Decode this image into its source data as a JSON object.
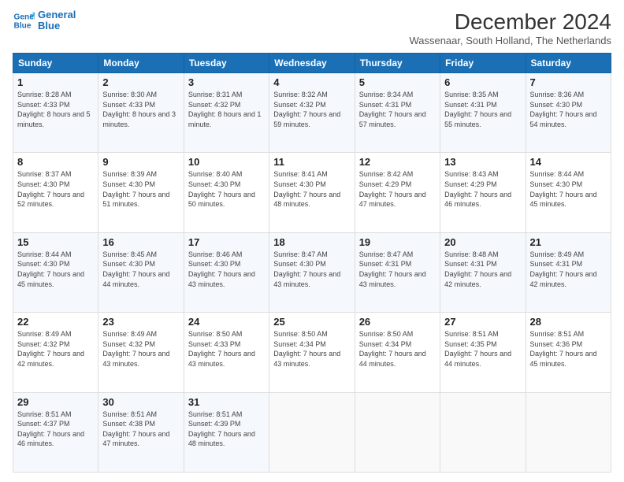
{
  "header": {
    "logo_line1": "General",
    "logo_line2": "Blue",
    "month_title": "December 2024",
    "subtitle": "Wassenaar, South Holland, The Netherlands"
  },
  "days_of_week": [
    "Sunday",
    "Monday",
    "Tuesday",
    "Wednesday",
    "Thursday",
    "Friday",
    "Saturday"
  ],
  "weeks": [
    [
      {
        "day": "1",
        "sunrise": "Sunrise: 8:28 AM",
        "sunset": "Sunset: 4:33 PM",
        "daylight": "Daylight: 8 hours and 5 minutes."
      },
      {
        "day": "2",
        "sunrise": "Sunrise: 8:30 AM",
        "sunset": "Sunset: 4:33 PM",
        "daylight": "Daylight: 8 hours and 3 minutes."
      },
      {
        "day": "3",
        "sunrise": "Sunrise: 8:31 AM",
        "sunset": "Sunset: 4:32 PM",
        "daylight": "Daylight: 8 hours and 1 minute."
      },
      {
        "day": "4",
        "sunrise": "Sunrise: 8:32 AM",
        "sunset": "Sunset: 4:32 PM",
        "daylight": "Daylight: 7 hours and 59 minutes."
      },
      {
        "day": "5",
        "sunrise": "Sunrise: 8:34 AM",
        "sunset": "Sunset: 4:31 PM",
        "daylight": "Daylight: 7 hours and 57 minutes."
      },
      {
        "day": "6",
        "sunrise": "Sunrise: 8:35 AM",
        "sunset": "Sunset: 4:31 PM",
        "daylight": "Daylight: 7 hours and 55 minutes."
      },
      {
        "day": "7",
        "sunrise": "Sunrise: 8:36 AM",
        "sunset": "Sunset: 4:30 PM",
        "daylight": "Daylight: 7 hours and 54 minutes."
      }
    ],
    [
      {
        "day": "8",
        "sunrise": "Sunrise: 8:37 AM",
        "sunset": "Sunset: 4:30 PM",
        "daylight": "Daylight: 7 hours and 52 minutes."
      },
      {
        "day": "9",
        "sunrise": "Sunrise: 8:39 AM",
        "sunset": "Sunset: 4:30 PM",
        "daylight": "Daylight: 7 hours and 51 minutes."
      },
      {
        "day": "10",
        "sunrise": "Sunrise: 8:40 AM",
        "sunset": "Sunset: 4:30 PM",
        "daylight": "Daylight: 7 hours and 50 minutes."
      },
      {
        "day": "11",
        "sunrise": "Sunrise: 8:41 AM",
        "sunset": "Sunset: 4:30 PM",
        "daylight": "Daylight: 7 hours and 48 minutes."
      },
      {
        "day": "12",
        "sunrise": "Sunrise: 8:42 AM",
        "sunset": "Sunset: 4:29 PM",
        "daylight": "Daylight: 7 hours and 47 minutes."
      },
      {
        "day": "13",
        "sunrise": "Sunrise: 8:43 AM",
        "sunset": "Sunset: 4:29 PM",
        "daylight": "Daylight: 7 hours and 46 minutes."
      },
      {
        "day": "14",
        "sunrise": "Sunrise: 8:44 AM",
        "sunset": "Sunset: 4:30 PM",
        "daylight": "Daylight: 7 hours and 45 minutes."
      }
    ],
    [
      {
        "day": "15",
        "sunrise": "Sunrise: 8:44 AM",
        "sunset": "Sunset: 4:30 PM",
        "daylight": "Daylight: 7 hours and 45 minutes."
      },
      {
        "day": "16",
        "sunrise": "Sunrise: 8:45 AM",
        "sunset": "Sunset: 4:30 PM",
        "daylight": "Daylight: 7 hours and 44 minutes."
      },
      {
        "day": "17",
        "sunrise": "Sunrise: 8:46 AM",
        "sunset": "Sunset: 4:30 PM",
        "daylight": "Daylight: 7 hours and 43 minutes."
      },
      {
        "day": "18",
        "sunrise": "Sunrise: 8:47 AM",
        "sunset": "Sunset: 4:30 PM",
        "daylight": "Daylight: 7 hours and 43 minutes."
      },
      {
        "day": "19",
        "sunrise": "Sunrise: 8:47 AM",
        "sunset": "Sunset: 4:31 PM",
        "daylight": "Daylight: 7 hours and 43 minutes."
      },
      {
        "day": "20",
        "sunrise": "Sunrise: 8:48 AM",
        "sunset": "Sunset: 4:31 PM",
        "daylight": "Daylight: 7 hours and 42 minutes."
      },
      {
        "day": "21",
        "sunrise": "Sunrise: 8:49 AM",
        "sunset": "Sunset: 4:31 PM",
        "daylight": "Daylight: 7 hours and 42 minutes."
      }
    ],
    [
      {
        "day": "22",
        "sunrise": "Sunrise: 8:49 AM",
        "sunset": "Sunset: 4:32 PM",
        "daylight": "Daylight: 7 hours and 42 minutes."
      },
      {
        "day": "23",
        "sunrise": "Sunrise: 8:49 AM",
        "sunset": "Sunset: 4:32 PM",
        "daylight": "Daylight: 7 hours and 43 minutes."
      },
      {
        "day": "24",
        "sunrise": "Sunrise: 8:50 AM",
        "sunset": "Sunset: 4:33 PM",
        "daylight": "Daylight: 7 hours and 43 minutes."
      },
      {
        "day": "25",
        "sunrise": "Sunrise: 8:50 AM",
        "sunset": "Sunset: 4:34 PM",
        "daylight": "Daylight: 7 hours and 43 minutes."
      },
      {
        "day": "26",
        "sunrise": "Sunrise: 8:50 AM",
        "sunset": "Sunset: 4:34 PM",
        "daylight": "Daylight: 7 hours and 44 minutes."
      },
      {
        "day": "27",
        "sunrise": "Sunrise: 8:51 AM",
        "sunset": "Sunset: 4:35 PM",
        "daylight": "Daylight: 7 hours and 44 minutes."
      },
      {
        "day": "28",
        "sunrise": "Sunrise: 8:51 AM",
        "sunset": "Sunset: 4:36 PM",
        "daylight": "Daylight: 7 hours and 45 minutes."
      }
    ],
    [
      {
        "day": "29",
        "sunrise": "Sunrise: 8:51 AM",
        "sunset": "Sunset: 4:37 PM",
        "daylight": "Daylight: 7 hours and 46 minutes."
      },
      {
        "day": "30",
        "sunrise": "Sunrise: 8:51 AM",
        "sunset": "Sunset: 4:38 PM",
        "daylight": "Daylight: 7 hours and 47 minutes."
      },
      {
        "day": "31",
        "sunrise": "Sunrise: 8:51 AM",
        "sunset": "Sunset: 4:39 PM",
        "daylight": "Daylight: 7 hours and 48 minutes."
      },
      null,
      null,
      null,
      null
    ]
  ]
}
